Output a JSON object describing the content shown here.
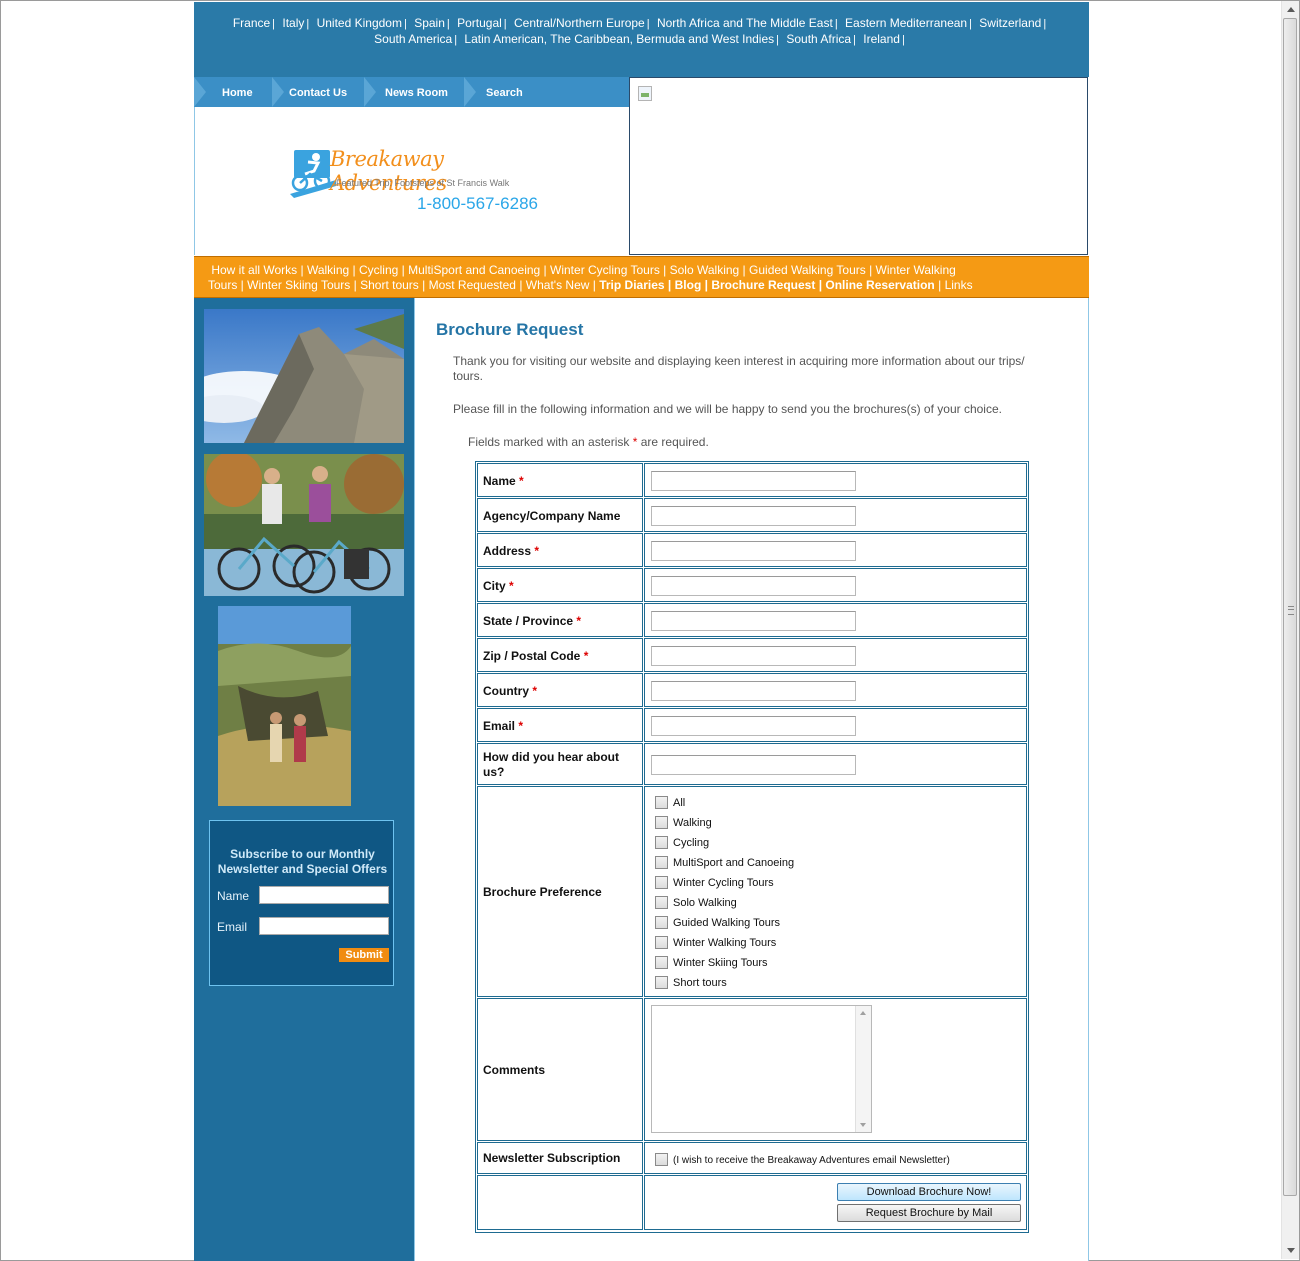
{
  "top_links": [
    "France",
    "Italy",
    "United Kingdom",
    "Spain",
    "Portugal",
    "Central/Northern Europe",
    "North Africa and The Middle East",
    "Eastern Mediterranean",
    "Switzerland",
    "South America",
    "Latin American, The Caribbean, Bermuda and West Indies",
    "South Africa",
    "Ireland"
  ],
  "nav": {
    "home": "Home",
    "contact": "Contact Us",
    "news": "News Room",
    "search": "Search"
  },
  "logo": {
    "name": "Breakaway Adventures",
    "featured": "Featured Trip: Footsteps of St Francis Walk",
    "phone": "1-800-567-6286"
  },
  "orange_links": [
    "How it all Works",
    "Walking",
    "Cycling",
    "MultiSport and Canoeing",
    "Winter Cycling Tours",
    "Solo Walking",
    "Guided Walking Tours",
    "Winter Walking Tours",
    "Winter Skiing Tours",
    "Short tours",
    "Most Requested",
    "What's New",
    "Trip Diaries",
    "Blog",
    "Brochure Request",
    "Online Reservation",
    "Links"
  ],
  "newsletter": {
    "title": "Subscribe to our Monthly Newsletter and Special Offers",
    "name_label": "Name",
    "email_label": "Email",
    "submit": "Submit"
  },
  "main": {
    "title": "Brochure Request",
    "intro": "Thank you for visiting our website and displaying keen interest in acquiring more information about our trips/ tours.",
    "instructions": "Please fill in the following information and we will be happy to send you the brochures(s) of your choice.",
    "required_prefix": "Fields marked with an asterisk",
    "required_suffix": "are required.",
    "asterisk": "*"
  },
  "form": {
    "name": "Name",
    "agency": "Agency/Company Name",
    "address": "Address",
    "city": "City",
    "state": "State / Province",
    "zip": "Zip / Postal Code",
    "country": "Country",
    "email": "Email",
    "hear": "How did you hear about us?",
    "brochure_pref": "Brochure Preference",
    "brochure_options": [
      "All",
      "Walking",
      "Cycling",
      "MultiSport and Canoeing",
      "Winter Cycling Tours",
      "Solo Walking",
      "Guided Walking Tours",
      "Winter Walking Tours",
      "Winter Skiing Tours",
      "Short tours"
    ],
    "comments": "Comments",
    "newsletter_sub": "Newsletter Subscription",
    "newsletter_note": "(I wish to receive the Breakaway Adventures email Newsletter)",
    "download_btn": "Download Brochure Now!",
    "mail_btn": "Request Brochure by Mail"
  },
  "colors": {
    "header_blue": "#2a7aa8",
    "sidebar_blue": "#1f6e9c",
    "orange": "#f59a14",
    "title_blue": "#2575a6"
  }
}
